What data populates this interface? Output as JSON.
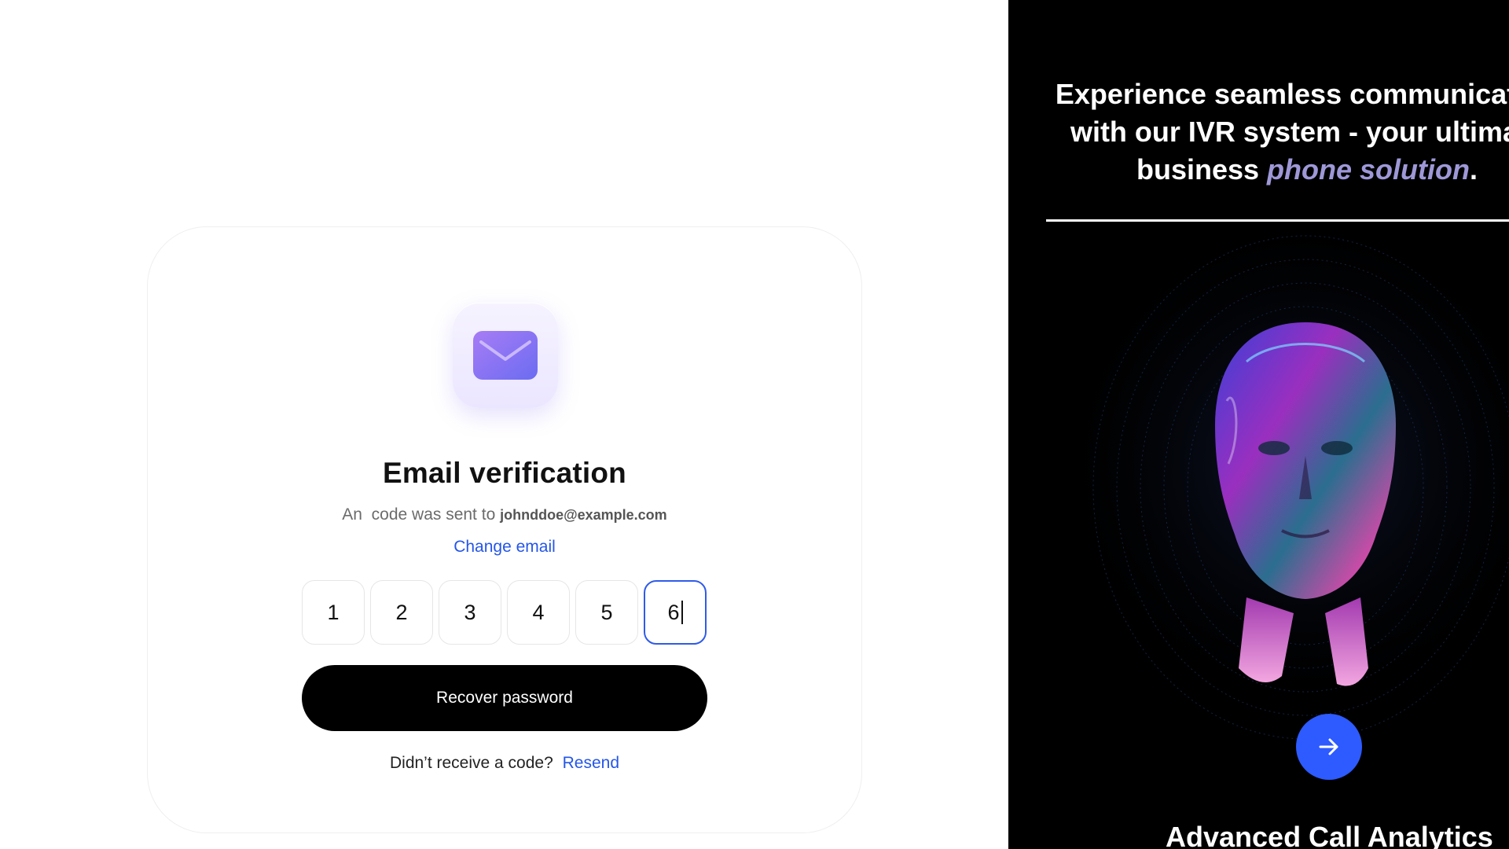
{
  "card": {
    "icon": "envelope-icon",
    "title": "Email verification",
    "subtitle_prefix": "An  code was sent to",
    "email": "johnddoe@example.com",
    "change_email_label": "Change email",
    "otp_digits": [
      "1",
      "2",
      "3",
      "4",
      "5",
      "6"
    ],
    "recover_label": "Recover password",
    "resend_prompt": "Didn’t receive a code?",
    "resend_label": "Resend"
  },
  "promo": {
    "headline_line1": "Experience seamless communication",
    "headline_line2": "with our IVR system - your ultimate",
    "headline_line3_prefix": "business",
    "headline_highlight": "phone solution",
    "headline_suffix": ".",
    "arrow_icon": "arrow-right-icon",
    "bottom_title": "Advanced Call Analytics"
  },
  "colors": {
    "accent_blue": "#2456e8",
    "arrow_button": "#2d5bff",
    "highlight_lavender": "#9e98d8",
    "panel_bg": "#000000"
  }
}
